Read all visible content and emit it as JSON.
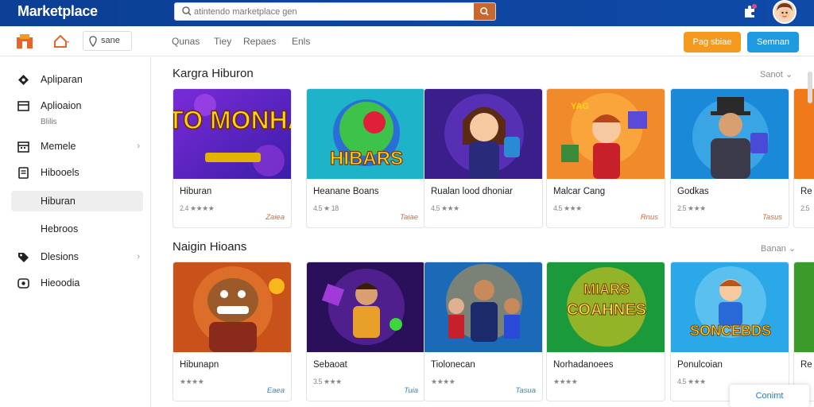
{
  "header": {
    "brand": "Marketplace",
    "search_placeholder": "atintendo marketplace gen"
  },
  "subbar": {
    "location_label": "sane",
    "nav": [
      "Qunas",
      "Tiey",
      "Repaes",
      "Enls"
    ],
    "orange_button": "Pag sbiae",
    "blue_button": "Semnan"
  },
  "sidebar": {
    "items": [
      {
        "label": "Apliparan",
        "icon": "diamond-icon"
      },
      {
        "label": "Aplioaion",
        "icon": "window-icon",
        "sub": "Blilis"
      },
      {
        "label": "Memele",
        "icon": "calendar-icon",
        "chevron": true
      },
      {
        "label": "Hibooels",
        "icon": "document-icon"
      },
      {
        "label": "Hiburan",
        "icon": "",
        "active": true
      },
      {
        "label": "Hebroos",
        "icon": ""
      },
      {
        "label": "Dlesions",
        "icon": "tag-icon",
        "chevron": true
      },
      {
        "label": "Hieoodia",
        "icon": "eye-icon"
      }
    ]
  },
  "sections": [
    {
      "title": "Kargra Hiburon",
      "sort": "Sanot",
      "cards": [
        {
          "name": "Hiburan",
          "rating": "2.4 ★★★★",
          "price": "Zaiea"
        },
        {
          "name": "Heanane Boans",
          "rating": "4.5 ★ 18",
          "price": "Taiae"
        },
        {
          "name": "Rualan lood dhoniar",
          "rating": "4.5 ★★★",
          "price": ""
        },
        {
          "name": "Malcar Cang",
          "rating": "4.5 ★★★",
          "price": "Rnus"
        },
        {
          "name": "Godkas",
          "rating": "2.5 ★★★",
          "price": "Tasus"
        },
        {
          "name": "Re",
          "rating": "2.5",
          "price": ""
        }
      ]
    },
    {
      "title": "Naigin Hioans",
      "sort": "Banan",
      "cards": [
        {
          "name": "Hibunapn",
          "rating": "★★★★",
          "price": "Eaea"
        },
        {
          "name": "Sebaoat",
          "rating": "3.5 ★★★",
          "price": "Tuia"
        },
        {
          "name": "Tiolonecan",
          "rating": "★★★★",
          "price": "Tasua"
        },
        {
          "name": "Norhadanoees",
          "rating": "★★★★",
          "price": ""
        },
        {
          "name": "Ponulcoian",
          "rating": "4.5 ★★★",
          "price": ""
        },
        {
          "name": "Re",
          "rating": "",
          "price": ""
        }
      ]
    }
  ],
  "thumbs": [
    {
      "icon": "game-art-ato-monha",
      "text": "ATO MONHA!"
    },
    {
      "icon": "game-art-hibars",
      "text": "HIBARS"
    },
    {
      "icon": "game-art-girl-hero",
      "text": ""
    },
    {
      "icon": "game-art-red-kid",
      "text": "YAG"
    },
    {
      "icon": "game-art-top-hat-man",
      "text": ""
    },
    {
      "icon": "game-art-partial",
      "text": ""
    },
    {
      "icon": "game-art-creature",
      "text": ""
    },
    {
      "icon": "game-art-purple-hero",
      "text": ""
    },
    {
      "icon": "game-art-team",
      "text": ""
    },
    {
      "icon": "game-art-coahnes",
      "text": "MIARS COAHNES"
    },
    {
      "icon": "game-art-soncebds",
      "text": "SONCEBDS"
    },
    {
      "icon": "game-art-partial-2",
      "text": ""
    }
  ],
  "floating_button": "Conimt",
  "colors": {
    "header_bg": "#0d47a1",
    "orange": "#f39a1f",
    "blue": "#1e9ae0",
    "price": "#e0672e"
  }
}
